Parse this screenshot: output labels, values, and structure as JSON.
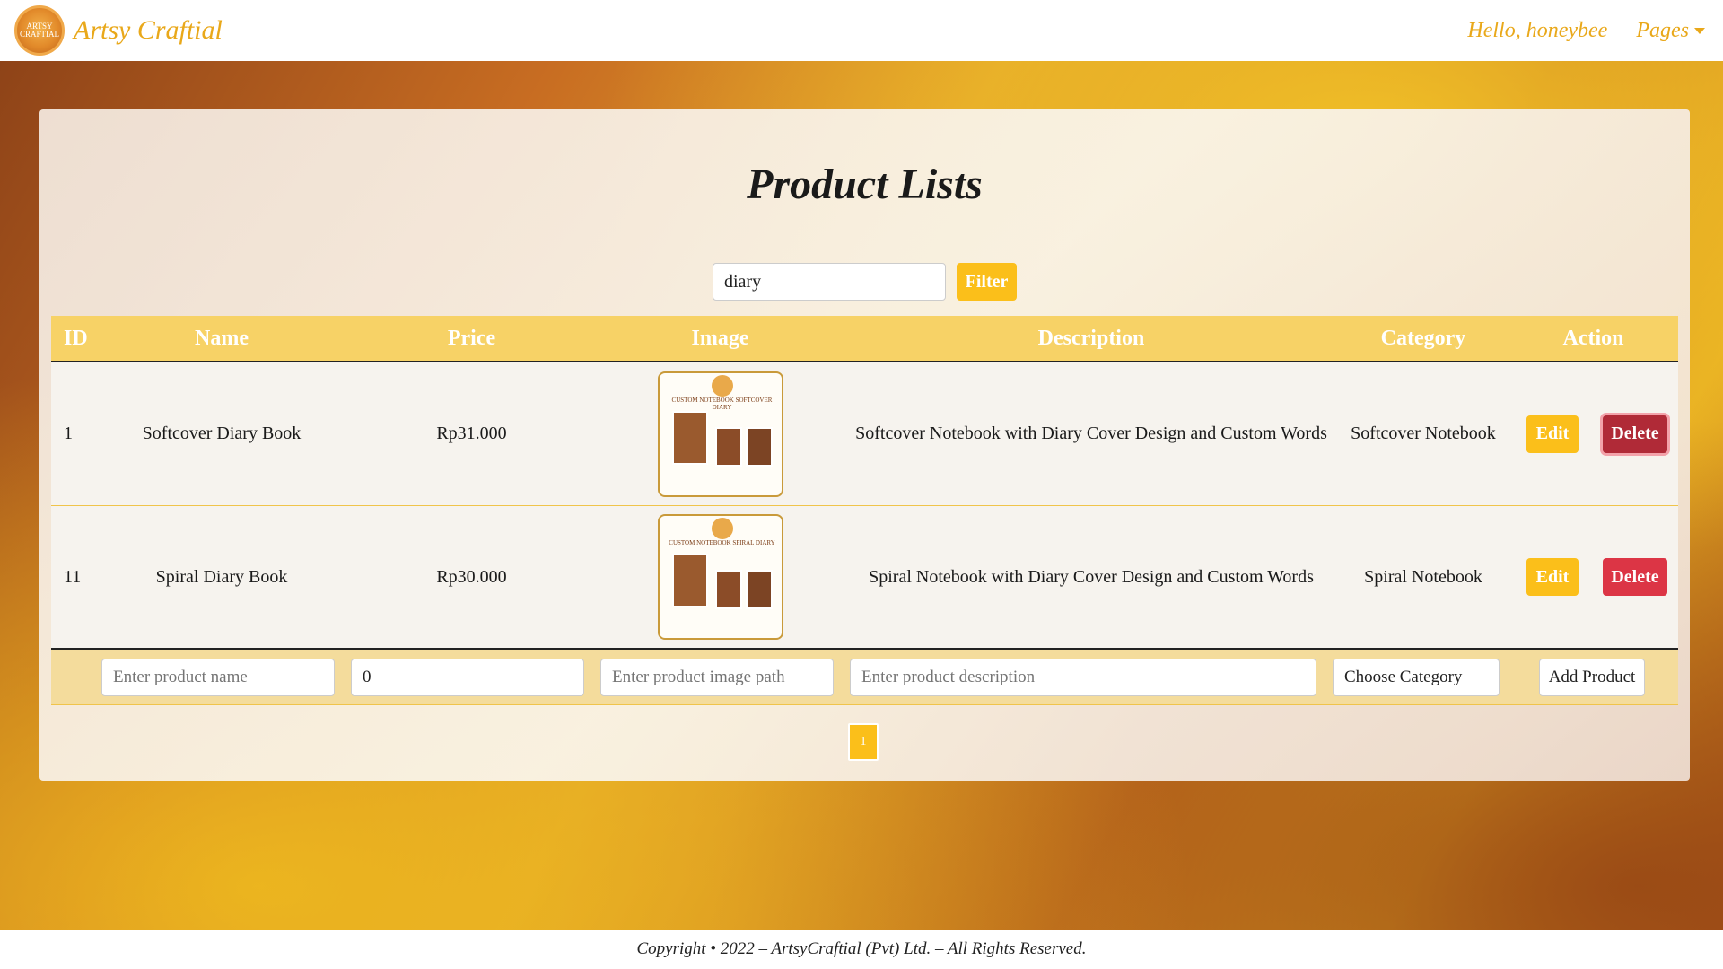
{
  "navbar": {
    "brand": "Artsy Craftial",
    "logo_text": "ARTSY CRAFTIAL",
    "greeting": "Hello, honeybee",
    "pages_label": "Pages"
  },
  "main": {
    "title": "Product Lists",
    "filter": {
      "value": "diary",
      "button": "Filter"
    },
    "table": {
      "headers": [
        "ID",
        "Name",
        "Price",
        "Image",
        "Description",
        "Category",
        "Action"
      ],
      "rows": [
        {
          "id": "1",
          "name": "Softcover Diary Book",
          "price": "Rp31.000",
          "image_caption": "CUSTOM NOTEBOOK SOFTCOVER DIARY",
          "description": "Softcover Notebook with Diary Cover Design and Custom Words",
          "category": "Softcover Notebook",
          "edit": "Edit",
          "delete": "Delete"
        },
        {
          "id": "11",
          "name": "Spiral Diary Book",
          "price": "Rp30.000",
          "image_caption": "CUSTOM NOTEBOOK SPIRAL DIARY",
          "description": "Spiral Notebook with Diary Cover Design and Custom Words",
          "category": "Spiral Notebook",
          "edit": "Edit",
          "delete": "Delete"
        }
      ]
    },
    "add_form": {
      "name_placeholder": "Enter product name",
      "price_value": "0",
      "image_placeholder": "Enter product image path",
      "description_placeholder": "Enter product description",
      "category_placeholder": "Choose Category",
      "button": "Add Product"
    },
    "pagination": {
      "current": "1"
    }
  },
  "footer": {
    "text": "Copyright • 2022 – ArtsyCraftial (Pvt) Ltd. – All Rights Reserved."
  },
  "colors": {
    "accent": "#fbbf1a",
    "danger": "#dc3545",
    "brand": "#e9a81a"
  }
}
